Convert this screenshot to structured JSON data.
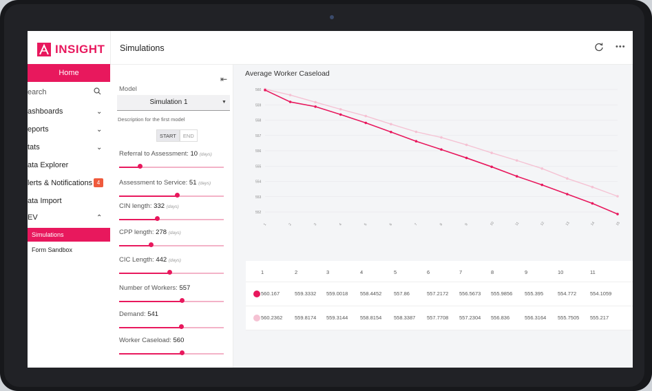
{
  "app": {
    "logo_text": "INSIGHT",
    "accent": "#e8185d"
  },
  "sidebar": {
    "home": "Home",
    "search_placeholder": "earch",
    "items": [
      {
        "label": "ashboards"
      },
      {
        "label": "eports"
      },
      {
        "label": "tats"
      },
      {
        "label": "ata Explorer"
      },
      {
        "label": "lerts & Notifications",
        "badge": "4"
      },
      {
        "label": "ata Import"
      },
      {
        "label": "EV"
      }
    ],
    "sub_items": [
      "Simulations",
      "Form Sandbox"
    ]
  },
  "header": {
    "title": "Simulations"
  },
  "controls": {
    "model_label": "Model",
    "model_value": "Simulation 1",
    "description": "Description for the first model",
    "toggle": [
      "START",
      "END"
    ],
    "params": [
      {
        "label": "Referral to Assessment:",
        "value": "10",
        "unit": "(days)",
        "level": 0.2
      },
      {
        "label": "Assessment to Service:",
        "value": "51",
        "unit": "(days)",
        "level": 0.55
      },
      {
        "label": "CIN length:",
        "value": "332",
        "unit": "(days)",
        "level": 0.36
      },
      {
        "label": "CPP length:",
        "value": "278",
        "unit": "(days)",
        "level": 0.3
      },
      {
        "label": "CIC Length:",
        "value": "442",
        "unit": "(days)",
        "level": 0.48
      },
      {
        "label": "Number of Workers:",
        "value": "557",
        "unit": "",
        "level": 0.6
      },
      {
        "label": "Demand:",
        "value": "541",
        "unit": "",
        "level": 0.59
      },
      {
        "label": "Worker Caseload:",
        "value": "560",
        "unit": "",
        "level": 0.6
      }
    ]
  },
  "chart_data": {
    "type": "line",
    "title": "Average Worker Caseload",
    "x": [
      1,
      2,
      3,
      4,
      5,
      6,
      7,
      8,
      9,
      10,
      11,
      12,
      13,
      14,
      15
    ],
    "ylim": [
      561.5,
      560.3
    ],
    "y_ticks": [
      "560",
      "559",
      "558",
      "557",
      "556",
      "555",
      "554",
      "553",
      "552"
    ],
    "x_ticks": [
      "1",
      "2",
      "3",
      "4",
      "5",
      "6",
      "7",
      "8",
      "9",
      "10",
      "11",
      "12",
      "13",
      "14",
      "15"
    ],
    "series": [
      {
        "color": "#e8185d",
        "values": [
          560.167,
          559.3332,
          559.0018,
          558.4452,
          557.86,
          557.2172,
          556.5673,
          555.9856,
          555.395,
          554.772,
          554.1059,
          553.5,
          552.85,
          552.2,
          551.45
        ]
      },
      {
        "color": "#f5c2d3",
        "values": [
          560.2362,
          559.8174,
          559.3144,
          558.8154,
          558.3387,
          557.7708,
          557.2304,
          556.836,
          556.3164,
          555.7505,
          555.217,
          554.65,
          553.95,
          553.35,
          552.7
        ]
      }
    ],
    "grid": true
  },
  "table": {
    "columns": [
      "1",
      "2",
      "3",
      "4",
      "5",
      "6",
      "7",
      "8",
      "9",
      "10",
      "11"
    ],
    "rows": [
      {
        "color": "#e8185d",
        "cells": [
          "560.167",
          "559.3332",
          "559.0018",
          "558.4452",
          "557.86",
          "557.2172",
          "556.5673",
          "555.9856",
          "555.395",
          "554.772",
          "554.1059"
        ]
      },
      {
        "color": "#f5c2d3",
        "cells": [
          "560.2362",
          "559.8174",
          "559.3144",
          "558.8154",
          "558.3387",
          "557.7708",
          "557.2304",
          "556.836",
          "556.3164",
          "555.7505",
          "555.217"
        ]
      }
    ]
  }
}
